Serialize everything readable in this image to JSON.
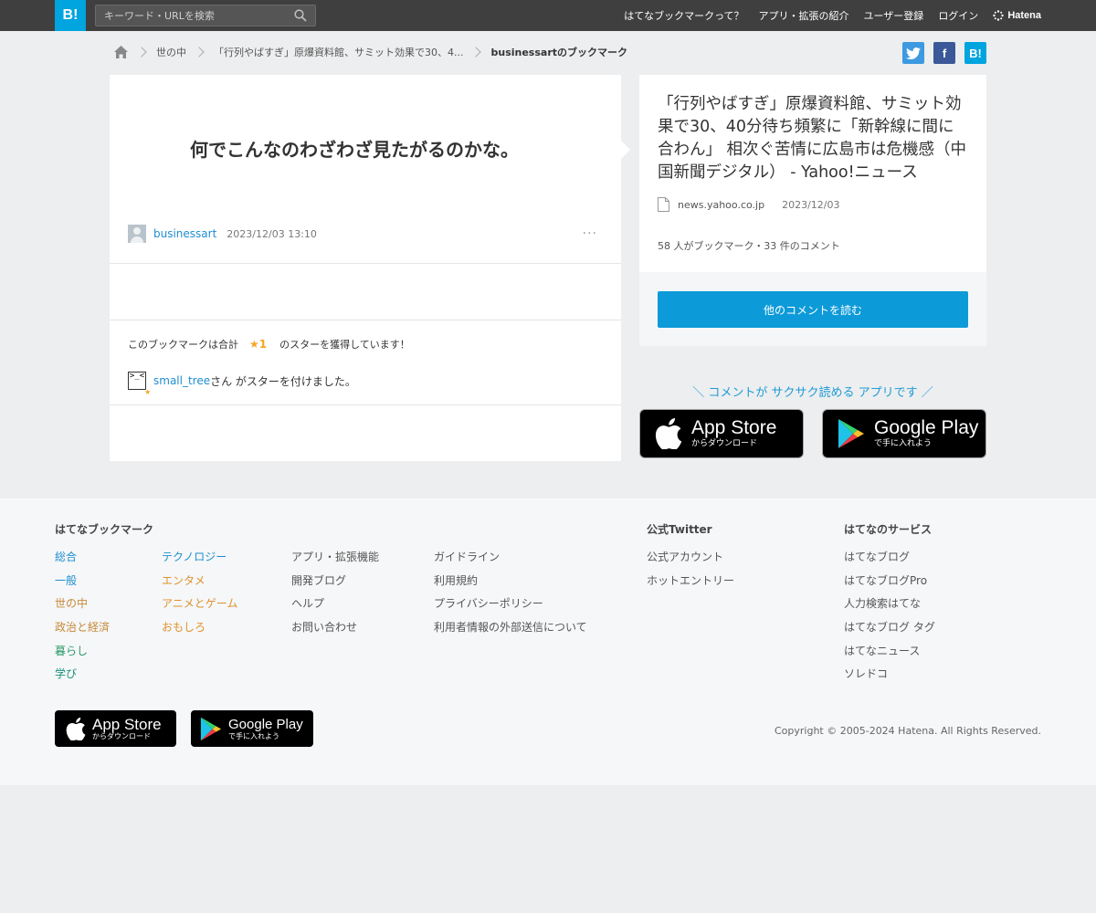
{
  "topbar": {
    "logo": "B!",
    "search_placeholder": "キーワード・URLを検索",
    "nav": [
      "はてなブックマークって？",
      "アプリ・拡張の紹介",
      "ユーザー登録",
      "ログイン"
    ],
    "brand": "Hatena"
  },
  "breadcrumb": {
    "category": "世の中",
    "entry": "「行列やばすぎ」原爆資料館、サミット効果で30、4...",
    "current": "businessartのブックマーク"
  },
  "share": {
    "twitter": "t",
    "facebook": "f",
    "hatena": "B!"
  },
  "bookmark": {
    "comment": "何でこんなのわざわざ見たがるのかな。",
    "user": "businessart",
    "datetime": "2023/12/03 13:10",
    "more": "···",
    "stars_prefix": "このブックマークは合計",
    "stars_count": "★1",
    "stars_suffix": "のスターを獲得しています！",
    "starrer_avatar": ">_<",
    "starrer_name": "small_tree",
    "starrer_rest": "さん がスターを付けました。"
  },
  "entry": {
    "title": "「行列やばすぎ」原爆資料館、サミット効果で30、40分待ち頻繁に「新幹線に間に合わん」 相次ぐ苦情に広島市は危機感（中国新聞デジタル） - Yahoo!ニュース",
    "domain": "news.yahoo.co.jp",
    "date": "2023/12/03",
    "count": "58 人がブックマーク・33 件のコメント",
    "read_more": "他のコメントを読む"
  },
  "promo": {
    "text": "＼ コメントが サクサク読める アプリです ／",
    "appstore_big": "App Store",
    "appstore_small": "からダウンロード",
    "googleplay_big": "Google Play",
    "googleplay_small": "で手に入れよう"
  },
  "footer": {
    "col1_title": "はてなブックマーク",
    "col1a": [
      "総合",
      "一般",
      "世の中",
      "政治と経済",
      "暮らし",
      "学び"
    ],
    "col1b": [
      "テクノロジー",
      "エンタメ",
      "アニメとゲーム",
      "おもしろ"
    ],
    "col1c": [
      "アプリ・拡張機能",
      "開発ブログ",
      "ヘルプ",
      "お問い合わせ"
    ],
    "col1d": [
      "ガイドライン",
      "利用規約",
      "プライバシーポリシー",
      "利用者情報の外部送信について"
    ],
    "col2_title": "公式Twitter",
    "col2": [
      "公式アカウント",
      "ホットエントリー"
    ],
    "col3_title": "はてなのサービス",
    "col3": [
      "はてなブログ",
      "はてなブログPro",
      "人力検索はてな",
      "はてなブログ タグ",
      "はてなニュース",
      "ソレドコ"
    ],
    "copyright": "Copyright © 2005-2024 Hatena. All Rights Reserved."
  },
  "colors": {
    "accent": "#00a4de",
    "button": "#0d9ad8",
    "topbar": "#3f3f3f",
    "star": "#f5a623"
  }
}
